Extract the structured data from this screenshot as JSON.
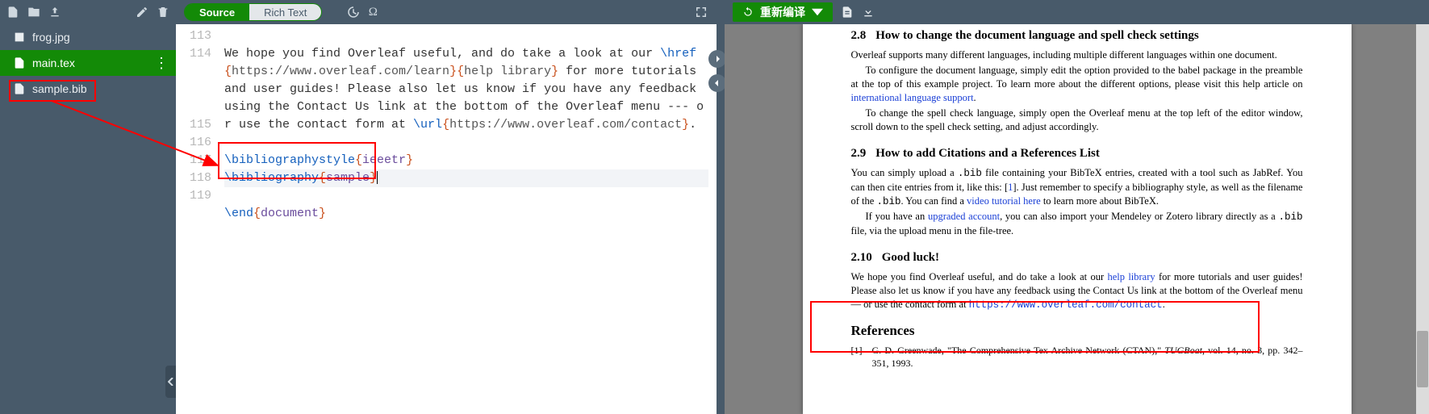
{
  "fileTree": {
    "toolbar": {
      "newFile": "new-file",
      "newFolder": "new-folder",
      "upload": "upload",
      "rename": "rename",
      "delete": "delete"
    },
    "items": [
      {
        "icon": "image-icon",
        "name": "frog.jpg",
        "active": false
      },
      {
        "icon": "file-icon",
        "name": "main.tex",
        "active": true
      },
      {
        "icon": "file-icon",
        "name": "sample.bib",
        "active": false
      }
    ]
  },
  "editor": {
    "tabs": {
      "source": "Source",
      "rich": "Rich Text"
    },
    "lines": [
      {
        "n": 113,
        "spans": []
      },
      {
        "n": 114,
        "spans": [
          {
            "t": "plain",
            "v": "We hope you find Overleaf useful, and do take a look at our "
          },
          {
            "t": "cmd",
            "v": "\\href"
          },
          {
            "t": "brace",
            "v": "{"
          },
          {
            "t": "url",
            "v": "https://www.overleaf.com/learn"
          },
          {
            "t": "brace",
            "v": "}"
          },
          {
            "t": "brace",
            "v": "{"
          },
          {
            "t": "param",
            "v": "help library"
          },
          {
            "t": "brace",
            "v": "}"
          },
          {
            "t": "plain",
            "v": " for more tutorials and user guides! Please also let us know if you have any feedback using the Contact Us link at the bottom of the Overleaf menu --- or use the contact form at "
          },
          {
            "t": "cmd",
            "v": "\\url"
          },
          {
            "t": "brace",
            "v": "{"
          },
          {
            "t": "url",
            "v": "https://www.overleaf.com/contact"
          },
          {
            "t": "brace",
            "v": "}"
          },
          {
            "t": "plain",
            "v": "."
          }
        ]
      },
      {
        "n": 115,
        "spans": []
      },
      {
        "n": 116,
        "spans": [
          {
            "t": "cmd",
            "v": "\\bibliographystyle"
          },
          {
            "t": "brace",
            "v": "{"
          },
          {
            "t": "arg",
            "v": "ieeetr"
          },
          {
            "t": "brace",
            "v": "}"
          }
        ]
      },
      {
        "n": 117,
        "hl": true,
        "spans": [
          {
            "t": "cmd",
            "v": "\\bibliography"
          },
          {
            "t": "brace",
            "v": "{"
          },
          {
            "t": "arg",
            "v": "sample"
          },
          {
            "t": "brace",
            "v": "}"
          },
          {
            "t": "cursor",
            "v": ""
          }
        ]
      },
      {
        "n": 118,
        "spans": []
      },
      {
        "n": 119,
        "spans": [
          {
            "t": "cmd",
            "v": "\\end"
          },
          {
            "t": "brace",
            "v": "{"
          },
          {
            "t": "arg",
            "v": "document"
          },
          {
            "t": "brace",
            "v": "}"
          }
        ]
      }
    ]
  },
  "pdf": {
    "recompile": "重新编译",
    "sections": {
      "s28": {
        "no": "2.8",
        "title": "How to change the document language and spell check settings",
        "p1": "Overleaf supports many different languages, including multiple different languages within one document.",
        "p2a": "To configure the document language, simply edit the option provided to the babel package in the preamble at the top of this example project. To learn more about the different options, please visit this help article on ",
        "p2link": "international language support",
        "p2b": ".",
        "p3": "To change the spell check language, simply open the Overleaf menu at the top left of the editor window, scroll down to the spell check setting, and adjust accordingly."
      },
      "s29": {
        "no": "2.9",
        "title": "How to add Citations and a References List",
        "p1a": "You can simply upload a ",
        "p1tt1": ".bib",
        "p1b": " file containing your BibTeX entries, created with a tool such as JabRef. You can then cite entries from it, like this: [",
        "p1cite": "1",
        "p1c": "]. Just remember to specify a bibliography style, as well as the filename of the ",
        "p1tt2": ".bib",
        "p1d": ". You can find a ",
        "p1link": "video tutorial here",
        "p1e": " to learn more about BibTeX.",
        "p2a": "If you have an ",
        "p2link": "upgraded account",
        "p2b": ", you can also import your Mendeley or Zotero library directly as a ",
        "p2tt": ".bib",
        "p2c": " file, via the upload menu in the file-tree."
      },
      "s210": {
        "no": "2.10",
        "title": "Good luck!",
        "p1a": "We hope you find Overleaf useful, and do take a look at our ",
        "p1link": "help library",
        "p1b": " for more tutorials and user guides! Please also let us know if you have any feedback using the Contact Us link at the bottom of the Overleaf menu — or use the contact form at ",
        "p1url": "https://www.overleaf.com/contact",
        "p1c": "."
      },
      "refs": {
        "title": "References",
        "items": [
          {
            "num": "[1]",
            "text1": "G. D. Greenwade, \"The Comprehensive Tex Archive Network (CTAN),\" ",
            "journal": "TUGBoat",
            "text2": ", vol. 14, no. 3, pp. 342–351, 1993."
          }
        ]
      }
    }
  }
}
